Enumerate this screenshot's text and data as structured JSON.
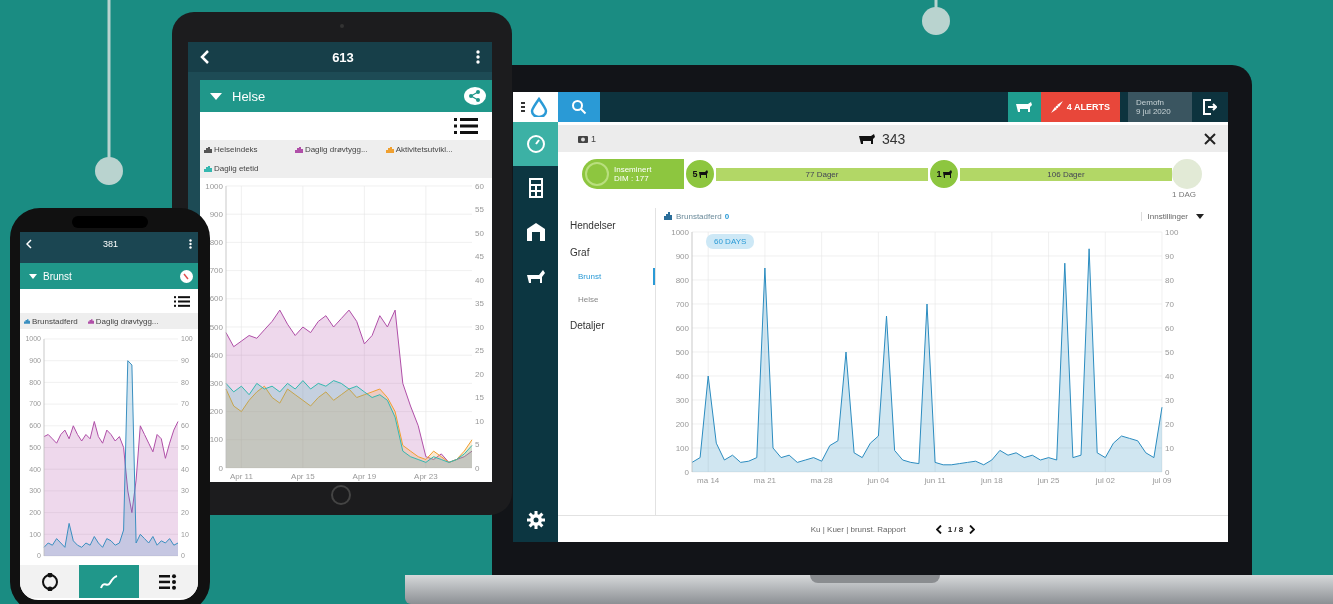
{
  "laptop": {
    "top_bar": {
      "alerts": "4 ALERTS",
      "user": "Demofn",
      "date": "9 jul 2020"
    },
    "sidebar": [
      {
        "kind": "gauge",
        "selected": true
      },
      {
        "kind": "grid",
        "selected": false
      },
      {
        "kind": "barn",
        "selected": false
      },
      {
        "kind": "animal",
        "selected": false
      }
    ],
    "card": {
      "camera_count": "1",
      "animal_id": "343"
    },
    "timeline": {
      "start_label": "Inseminert",
      "start_sub": "DIM : 177",
      "stages": [
        {
          "count": "5",
          "duration": "77 Dager"
        },
        {
          "count": "1",
          "duration": "106 Dager"
        }
      ],
      "end_label": "1 DAG"
    },
    "nav": [
      {
        "label": "Hendelser",
        "kind": "section",
        "selected": false
      },
      {
        "label": "Graf",
        "kind": "section",
        "selected": false
      },
      {
        "label": "Brunst",
        "kind": "sub",
        "selected": true
      },
      {
        "label": "Helse",
        "kind": "sub",
        "selected": false
      },
      {
        "label": "Detaljer",
        "kind": "section",
        "selected": false
      }
    ],
    "chart_count": "0",
    "settings": "Innstillinger",
    "range_badge": "60 DAYS",
    "chart_data": {
      "type": "area",
      "grid": true,
      "ylim": [
        0,
        1000
      ],
      "yticks": [
        0,
        100,
        200,
        300,
        400,
        500,
        600,
        700,
        800,
        900,
        1000
      ],
      "categories": [
        null,
        null,
        "ma 14",
        null,
        null,
        null,
        null,
        null,
        null,
        "ma 21",
        null,
        null,
        null,
        null,
        null,
        null,
        "ma 28",
        null,
        null,
        null,
        null,
        null,
        null,
        "jun 04",
        null,
        null,
        null,
        null,
        null,
        null,
        "jun 11",
        null,
        null,
        null,
        null,
        null,
        null,
        "jun 18",
        null,
        null,
        null,
        null,
        null,
        null,
        "jun 25",
        null,
        null,
        null,
        null,
        null,
        null,
        "jul 02",
        null,
        null,
        null,
        null,
        null,
        null,
        "jul 09"
      ],
      "series": [
        {
          "name": "Brunstadferd",
          "color": "#2b8cc0",
          "values": [
            40,
            60,
            400,
            120,
            50,
            70,
            40,
            45,
            60,
            850,
            100,
            60,
            70,
            40,
            50,
            60,
            45,
            110,
            130,
            500,
            80,
            60,
            120,
            150,
            650,
            90,
            50,
            40,
            35,
            700,
            40,
            30,
            30,
            35,
            40,
            45,
            30,
            50,
            90,
            70,
            80,
            60,
            70,
            50,
            60,
            50,
            870,
            60,
            70,
            930,
            80,
            60,
            120,
            150,
            140,
            130,
            80,
            60,
            270
          ]
        }
      ]
    },
    "right_ticks": [
      "100",
      "90",
      "80",
      "70",
      "60",
      "50",
      "40",
      "30",
      "20",
      "10",
      "0"
    ],
    "footer": {
      "breadcrumb": "Ku | Kuer | brunst. Rapport",
      "pager": "1 / 8"
    }
  },
  "tablet": {
    "title": "613",
    "section": "Helse",
    "chart_data": {
      "type": "area",
      "grid": true,
      "ylim": [
        0,
        1000
      ],
      "yticks": [
        0,
        100,
        200,
        300,
        400,
        500,
        600,
        700,
        800,
        900,
        1000
      ],
      "categories": [
        null,
        null,
        "Apr 11",
        null,
        null,
        null,
        null,
        null,
        null,
        null,
        "Apr 15",
        null,
        null,
        null,
        null,
        null,
        null,
        null,
        "Apr 19",
        null,
        null,
        null,
        null,
        null,
        null,
        null,
        "Apr 23",
        null,
        null,
        null,
        null,
        null,
        null
      ],
      "series": [
        {
          "name": "Helseindeks",
          "color": "#555555",
          "values": [
            null,
            null,
            null,
            null,
            null,
            null,
            null,
            null,
            null,
            null,
            null,
            null,
            null,
            null,
            null,
            null,
            null,
            null,
            null,
            null,
            null,
            null,
            null,
            null,
            null,
            null,
            null,
            null,
            null,
            null,
            null,
            null,
            null
          ]
        },
        {
          "name": "Daglig drøvtygg...",
          "color": "#b04fa8",
          "values": [
            480,
            430,
            450,
            470,
            460,
            490,
            520,
            560,
            510,
            470,
            500,
            480,
            520,
            540,
            500,
            530,
            560,
            520,
            440,
            470,
            540,
            500,
            560,
            300,
            220,
            150,
            40,
            30,
            50,
            20,
            30,
            40,
            60
          ]
        },
        {
          "name": "Aktivitetsutvikl...",
          "color": "#f0a030",
          "values": [
            280,
            220,
            200,
            240,
            270,
            290,
            250,
            230,
            280,
            260,
            240,
            220,
            250,
            270,
            240,
            260,
            280,
            250,
            260,
            270,
            280,
            250,
            200,
            80,
            60,
            40,
            30,
            60,
            40,
            20,
            30,
            60,
            100
          ]
        },
        {
          "name": "Daglig etetid",
          "color": "#35b8b0",
          "values": [
            300,
            270,
            290,
            260,
            300,
            280,
            290,
            270,
            300,
            280,
            310,
            280,
            300,
            290,
            310,
            300,
            280,
            290,
            270,
            250,
            260,
            240,
            180,
            60,
            40,
            30,
            20,
            40,
            30,
            20,
            30,
            50,
            80
          ]
        }
      ]
    },
    "right_ticks": [
      "60",
      "55",
      "50",
      "45",
      "40",
      "35",
      "30",
      "25",
      "20",
      "15",
      "10",
      "5",
      "0"
    ]
  },
  "phone": {
    "title": "381",
    "section": "Brunst",
    "chart_data": {
      "type": "area",
      "grid": true,
      "ylim": [
        0,
        1000
      ],
      "yticks": [
        0,
        100,
        200,
        300,
        400,
        500,
        600,
        700,
        800,
        900,
        1000
      ],
      "categories": [
        null,
        null,
        null,
        null,
        null,
        null,
        null,
        null,
        null,
        null,
        null,
        null,
        null,
        null,
        null,
        null,
        null,
        null,
        null,
        null,
        null,
        null,
        null,
        null,
        null,
        null,
        null,
        null,
        null,
        null,
        null,
        null,
        null
      ],
      "series": [
        {
          "name": "Brunstadferd",
          "color": "#3a8fc0",
          "values": [
            40,
            60,
            50,
            80,
            60,
            40,
            150,
            70,
            50,
            40,
            60,
            50,
            90,
            60,
            40,
            80,
            70,
            50,
            60,
            120,
            900,
            880,
            60,
            100,
            80,
            60,
            90,
            50,
            70,
            60,
            80,
            50,
            60
          ]
        },
        {
          "name": "Daglig drøvtygg...",
          "color": "#b04fa8",
          "values": [
            550,
            560,
            540,
            520,
            560,
            580,
            540,
            600,
            560,
            530,
            560,
            540,
            620,
            550,
            520,
            580,
            560,
            530,
            550,
            500,
            300,
            200,
            350,
            600,
            560,
            520,
            480,
            560,
            540,
            450,
            520,
            580,
            620
          ]
        }
      ]
    },
    "right_ticks": [
      "100",
      "90",
      "80",
      "70",
      "60",
      "50",
      "40",
      "30",
      "20",
      "10",
      "0"
    ],
    "bottom_nav": [
      {
        "kind": "cycle",
        "selected": false
      },
      {
        "kind": "trend",
        "selected": true
      },
      {
        "kind": "list",
        "selected": false
      }
    ]
  }
}
